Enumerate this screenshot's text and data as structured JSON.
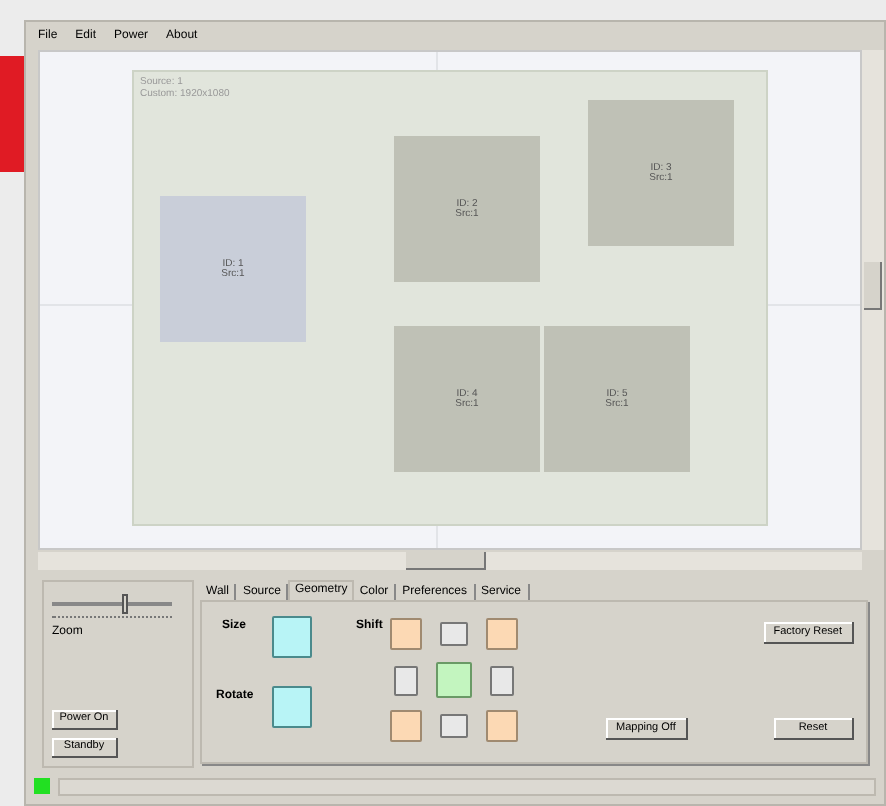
{
  "menu": [
    "File",
    "Edit",
    "Power",
    "About"
  ],
  "wall": {
    "info": [
      "Source: 1",
      "Custom: 1920x1080"
    ],
    "displays": [
      {
        "lines": [
          "ID: 1",
          "Src:1"
        ],
        "selected": true
      },
      {
        "lines": [
          "ID: 2",
          "Src:1"
        ],
        "selected": false
      },
      {
        "lines": [
          "ID: 3",
          "Src:1"
        ],
        "selected": false
      },
      {
        "lines": [
          "ID: 4",
          "Src:1"
        ],
        "selected": false
      },
      {
        "lines": [
          "ID: 5",
          "Src:1"
        ],
        "selected": false
      }
    ]
  },
  "zoom": {
    "label": "Zoom",
    "level": 0.62
  },
  "left_buttons": [
    "Power On",
    "Standby"
  ],
  "tabs": [
    {
      "label": "Wall",
      "selected": false
    },
    {
      "label": "Source",
      "selected": false
    },
    {
      "label": "Geometry",
      "selected": true
    },
    {
      "label": "Color",
      "selected": false
    },
    {
      "label": "Preferences",
      "selected": false
    },
    {
      "label": "Service",
      "selected": false
    }
  ],
  "geometry": {
    "size_label": "Size",
    "rotate_label": "Rotate",
    "shift_label": "Shift",
    "shift_pad": [
      {
        "kind": "corner"
      },
      {
        "kind": "edge"
      },
      {
        "kind": "corner"
      },
      {
        "kind": "edge"
      },
      {
        "kind": "center"
      },
      {
        "kind": "edge"
      },
      {
        "kind": "corner"
      },
      {
        "kind": "edge"
      },
      {
        "kind": "corner"
      }
    ],
    "buttons": {
      "factory_reset": "Factory Reset",
      "mapping": "Mapping Off",
      "reset": "Reset"
    }
  },
  "status_light": {
    "on": true
  }
}
